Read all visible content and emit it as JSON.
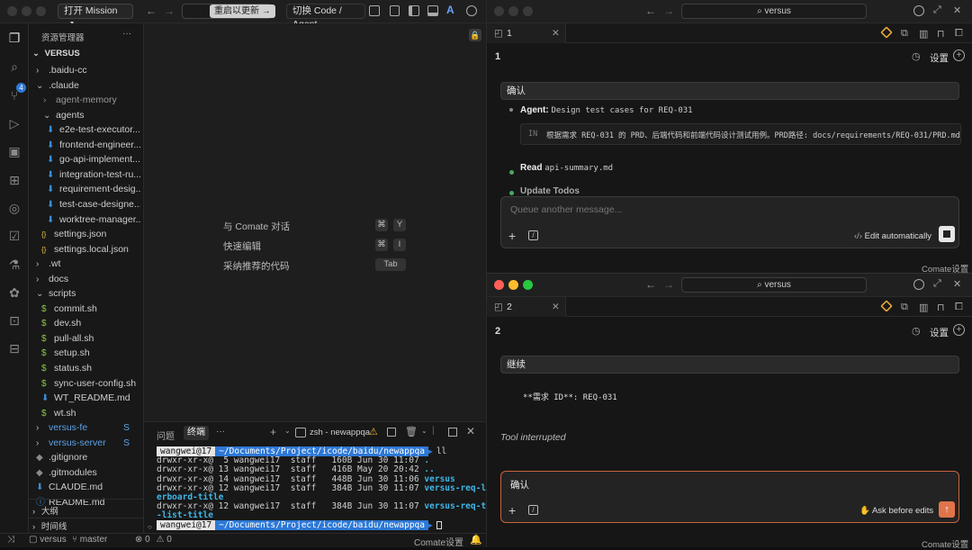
{
  "left_window": {
    "mission_button": "打开 Mission",
    "mission_icon": "external-link-icon",
    "update_button": "重启以更新",
    "update_arrow": "→",
    "mode_switch": "切换 Code / Agent",
    "explorer": {
      "title": "资源管理器",
      "more": "···",
      "root": "VERSUS",
      "items": [
        {
          "label": ".baidu-cc",
          "kind": "folder-closed"
        },
        {
          "label": ".claude",
          "kind": "folder-open"
        },
        {
          "label": "agent-memory",
          "kind": "folder-closed-dim"
        },
        {
          "label": "agents",
          "kind": "folder-open"
        },
        {
          "label": "e2e-test-executor...",
          "kind": "md"
        },
        {
          "label": "frontend-engineer...",
          "kind": "md"
        },
        {
          "label": "go-api-implement...",
          "kind": "md"
        },
        {
          "label": "integration-test-ru...",
          "kind": "md"
        },
        {
          "label": "requirement-desig...",
          "kind": "md"
        },
        {
          "label": "test-case-designe...",
          "kind": "md"
        },
        {
          "label": "worktree-manager...",
          "kind": "md"
        },
        {
          "label": "settings.json",
          "kind": "json"
        },
        {
          "label": "settings.local.json",
          "kind": "json"
        },
        {
          "label": ".wt",
          "kind": "folder-closed"
        },
        {
          "label": "docs",
          "kind": "folder-closed"
        },
        {
          "label": "scripts",
          "kind": "folder-open"
        },
        {
          "label": "commit.sh",
          "kind": "sh"
        },
        {
          "label": "dev.sh",
          "kind": "sh"
        },
        {
          "label": "pull-all.sh",
          "kind": "sh"
        },
        {
          "label": "setup.sh",
          "kind": "sh"
        },
        {
          "label": "status.sh",
          "kind": "sh"
        },
        {
          "label": "sync-user-config.sh",
          "kind": "sh"
        },
        {
          "label": "WT_README.md",
          "kind": "md"
        },
        {
          "label": "wt.sh",
          "kind": "sh"
        },
        {
          "label": "versus-fe",
          "kind": "submodule",
          "badge": "S"
        },
        {
          "label": "versus-server",
          "kind": "submodule",
          "badge": "S"
        },
        {
          "label": ".gitignore",
          "kind": "git"
        },
        {
          "label": ".gitmodules",
          "kind": "git"
        },
        {
          "label": "CLAUDE.md",
          "kind": "md"
        },
        {
          "label": "README.md",
          "kind": "info"
        }
      ],
      "outline": "大纲",
      "timeline": "时间线"
    },
    "activity_badge": "4",
    "editor_hints": [
      {
        "label": "与 Comate 对话",
        "keys": [
          "⌘",
          "Y"
        ]
      },
      {
        "label": "快速编辑",
        "keys": [
          "⌘",
          "I"
        ]
      },
      {
        "label": "采纳推荐的代码",
        "keys": [
          "Tab"
        ]
      }
    ],
    "panel": {
      "tab_problems": "问题",
      "tab_terminal": "终端",
      "more": "···",
      "terminal_name": "zsh - newappqa",
      "terminal_lines": [
        {
          "type": "prompt",
          "user": "wangwei@17",
          "path": "~/Documents/Project/icode/baidu/newappqa",
          "cmd": "ll"
        },
        {
          "type": "out",
          "text": "drwxr-xr-x@  5 wangwei17  staff   160B Jun 30 11:07 ",
          "name": "."
        },
        {
          "type": "out",
          "text": "drwxr-xr-x@ 13 wangwei17  staff   416B May 20 20:42 ",
          "name": ".."
        },
        {
          "type": "out",
          "text": "drwxr-xr-x@ 14 wangwei17  staff   448B Jun 30 11:06 ",
          "name": "versus"
        },
        {
          "type": "out",
          "text": "drwxr-xr-x@ 12 wangwei17  staff   384B Jun 30 11:07 ",
          "name": "versus-req-lead"
        },
        {
          "type": "cont",
          "name": "erboard-title"
        },
        {
          "type": "out",
          "text": "drwxr-xr-x@ 12 wangwei17  staff   384B Jun 30 11:07 ",
          "name": "versus-req-task"
        },
        {
          "type": "cont",
          "name": "-list-title"
        },
        {
          "type": "prompt",
          "user": "wangwei@17",
          "path": "~/Documents/Project/icode/baidu/newappqa",
          "cmd": ""
        }
      ]
    },
    "status": {
      "project": "versus",
      "branch": "master",
      "errors": "0",
      "warnings": "0",
      "comate": "Comate设置"
    }
  },
  "chat_windows": [
    {
      "search": "versus",
      "tab_label": "1",
      "session_title": "1",
      "settings": "设置",
      "user_message": "确认",
      "steps": [
        {
          "kind": "agent",
          "label": "Agent:",
          "detail": "Design test cases for REQ-031"
        },
        {
          "kind": "agent-in",
          "prefix": "IN",
          "detail": "根据需求 REQ-031 的 PRD、后端代码和前端代码设计测试用例。PRD路径: docs/requirements/REQ-031/PRD.md,"
        },
        {
          "kind": "read",
          "label": "Read",
          "detail": "api-summary.md"
        },
        {
          "kind": "todos",
          "label": "Update Todos",
          "detail": ""
        }
      ],
      "input_placeholder": "Queue another message...",
      "input_value": "",
      "mode_label": "Edit automatically",
      "footer": "Comate设置"
    },
    {
      "search": "versus",
      "tab_label": "2",
      "session_title": "2",
      "settings": "设置",
      "user_message": "继续",
      "content_line": "**需求 ID**: REQ-031",
      "interrupted": "Tool interrupted",
      "input_value": "确认",
      "mode_label": "Ask before edits",
      "footer": "Comate设置"
    }
  ],
  "colors": {
    "accent_blue": "#2d78d6",
    "terminal_cyan": "#3fb6e8",
    "step_green": "#4aa860",
    "send_orange": "#e0744a",
    "traffic_red": "#ff5f57",
    "traffic_yellow": "#febc2e",
    "traffic_green": "#28c840"
  }
}
